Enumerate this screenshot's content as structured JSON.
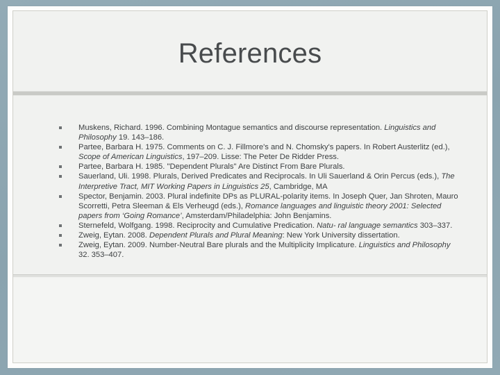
{
  "slide": {
    "title": "References",
    "theme": {
      "canvas_color": "#8da6b1",
      "frame_color": "#fdfdfc",
      "content_color": "#f1f2f0",
      "title_color": "#484b4d",
      "body_text_color": "#3b3e40",
      "bullet_color": "#6d7173",
      "divider_color": "#c9cac6"
    },
    "bullet_glyph": "square-bullet",
    "references": [
      {
        "id": "muskens-1996",
        "parts": [
          {
            "text": "Muskens, Richard. 1996. Combining Montague semantics and discourse representation. ",
            "style": "normal"
          },
          {
            "text": "Linguistics and Philosophy",
            "style": "italic"
          },
          {
            "text": " 19. 143–186.",
            "style": "normal"
          }
        ]
      },
      {
        "id": "partee-1975",
        "parts": [
          {
            "text": "Partee, Barbara H. 1975. Comments on C. J. Fillmore's and N. Chomsky's papers. In Robert Austerlitz (ed.), ",
            "style": "normal"
          },
          {
            "text": "Scope of American Linguistics",
            "style": "italic"
          },
          {
            "text": ", 197–209. Lisse: The Peter De Ridder Press.",
            "style": "normal"
          }
        ]
      },
      {
        "id": "partee-1985",
        "parts": [
          {
            "text": "Partee, Barbara H. 1985. \"Dependent Plurals\" Are Distinct From Bare Plurals.",
            "style": "normal"
          }
        ]
      },
      {
        "id": "sauerland-1998",
        "parts": [
          {
            "text": "Sauerland, Uli. 1998. Plurals, Derived Predicates and Reciprocals. In Uli Sauerland & Orin Percus (eds.), ",
            "style": "normal"
          },
          {
            "text": "The Interpretive Tract, MIT Working Papers in Linguistics 25",
            "style": "italic"
          },
          {
            "text": ", Cambridge, MA",
            "style": "normal"
          }
        ]
      },
      {
        "id": "spector-2003",
        "parts": [
          {
            "text": "Spector, Benjamin. 2003. Plural indefinite DPs as PLURAL-polarity items. In Joseph Quer, Jan Shroten, Mauro Scorretti, Petra Sleeman & Els Verheugd (eds.), ",
            "style": "normal"
          },
          {
            "text": "Romance languages and linguistic theory 2001: Selected papers from ‘Going Romance’",
            "style": "italic"
          },
          {
            "text": ", Amsterdam/Philadelphia: John Benjamins.",
            "style": "normal"
          }
        ]
      },
      {
        "id": "sternefeld-1998",
        "parts": [
          {
            "text": "Sternefeld, Wolfgang. 1998. Reciprocity and Cumulative Predication. ",
            "style": "normal"
          },
          {
            "text": "Natu- ral language semantics",
            "style": "italic"
          },
          {
            "text": " 303–337.",
            "style": "normal"
          }
        ]
      },
      {
        "id": "zweig-2008",
        "parts": [
          {
            "text": "Zweig, Eytan. 2008. ",
            "style": "normal"
          },
          {
            "text": "Dependent Plurals and Plural Meaning",
            "style": "italic"
          },
          {
            "text": ": New York University dissertation.",
            "style": "normal"
          }
        ]
      },
      {
        "id": "zweig-2009",
        "parts": [
          {
            "text": "Zweig, Eytan. 2009. Number-Neutral Bare plurals and the Multiplicity Implicature. ",
            "style": "normal"
          },
          {
            "text": "Linguistics and Philosophy",
            "style": "italic"
          },
          {
            "text": " 32. 353–407.",
            "style": "normal"
          }
        ]
      }
    ]
  }
}
